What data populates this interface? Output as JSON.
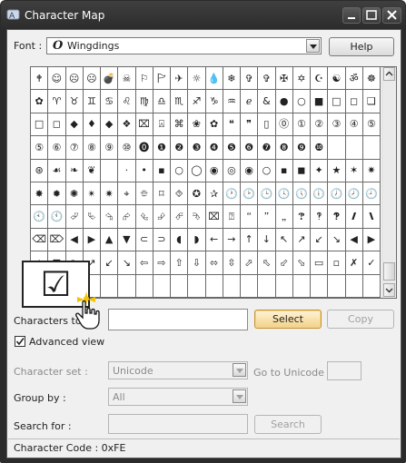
{
  "window": {
    "title": "Character Map"
  },
  "font": {
    "label": "Font :",
    "icon_glyph": "O",
    "value": "Wingdings"
  },
  "buttons": {
    "help": "Help",
    "select": "Select",
    "copy": "Copy",
    "search": "Search"
  },
  "copy_field": {
    "label": "Characters to c",
    "value": ""
  },
  "advanced_view": {
    "label": "Advanced view",
    "checked": true
  },
  "character_set": {
    "label": "Character set :",
    "value": "Unicode"
  },
  "goto_unicode": {
    "label": "Go to Unicode :",
    "value": ""
  },
  "group_by": {
    "label": "Group by :",
    "value": "All"
  },
  "search": {
    "label": "Search for :",
    "value": ""
  },
  "status": {
    "text": "Character Code : 0xFE"
  },
  "popup": {
    "glyph": "☑"
  },
  "grid": {
    "rows": [
      [
        "🕈",
        "☺",
        "☹",
        "☹",
        "💣",
        "☠",
        "⚐",
        "🏱",
        "✈",
        "☼",
        "💧",
        "❄",
        "✞",
        "✞",
        "✠",
        "✡",
        "☪",
        "☯",
        "ॐ",
        "☸"
      ],
      [
        "✿",
        "♈",
        "♉",
        "♊",
        "♋",
        "♌",
        "♍",
        "♎",
        "♏",
        "♐",
        "♑",
        "♒",
        "ℯ",
        "&",
        "●",
        "○",
        "■",
        "□",
        "◻",
        "❑"
      ],
      [
        "□",
        "◻",
        "◆",
        "♦",
        "◆",
        "❖",
        "⌧",
        "⍓",
        "⌘",
        "❀",
        "✿",
        "❝",
        "❞",
        "▯",
        "⓪",
        "①",
        "②",
        "③",
        "④",
        "⑤"
      ],
      [
        "⑤",
        "⑥",
        "⑦",
        "⑧",
        "⑨",
        "⑩",
        "⓿",
        "❶",
        "❷",
        "❸",
        "❹",
        "❺",
        "❻",
        "❼",
        "❽",
        "❾",
        "❿",
        "",
        "",
        ""
      ],
      [
        "⊛",
        "☙",
        "❧",
        "❦",
        "",
        "·",
        "•",
        "▪",
        "○",
        "◯",
        "◉",
        "◎",
        "◉",
        "○",
        "▪",
        "◼",
        "✦",
        "★",
        "✶",
        "✷"
      ],
      [
        "✸",
        "✹",
        "✺",
        "✴",
        "✷",
        "⌖",
        "⯐",
        "⌑",
        "⯑",
        "✪",
        "✰",
        "🕐",
        "🕑",
        "🕒",
        "🕓",
        "🕔",
        "🕕",
        "🕖",
        "🕗",
        "🕘"
      ],
      [
        "🕙",
        "🕚",
        "⮰",
        "⮱",
        "⮲",
        "⮳",
        "⮴",
        "⮵",
        "⮶",
        "⮷",
        "⌧",
        "⍰",
        "🙶",
        "🙷",
        "🙸",
        "🙹",
        "🙺",
        "🙻",
        "🙼",
        "🙽"
      ],
      [
        "⌫",
        "⌦",
        "◀",
        "▶",
        "▲",
        "▼",
        "⊂",
        "⊃",
        "◖",
        "◗",
        "←",
        "→",
        "↑",
        "↓",
        "↖",
        "↗",
        "↙",
        "↘",
        "◀",
        "▶"
      ],
      [
        "▲",
        "▼",
        "↖",
        "↗",
        "↙",
        "↘",
        "⇦",
        "⇨",
        "⇧",
        "⇩",
        "⬄",
        "⇳",
        "⬀",
        "⬁",
        "⬃",
        "⬂",
        "▭",
        "▫",
        "✗",
        "✓"
      ],
      [
        "☒",
        "☑",
        "",
        "",
        "",
        "",
        "",
        "",
        "",
        "",
        "",
        "",
        "",
        "",
        "",
        "",
        "",
        "",
        "",
        ""
      ]
    ]
  }
}
